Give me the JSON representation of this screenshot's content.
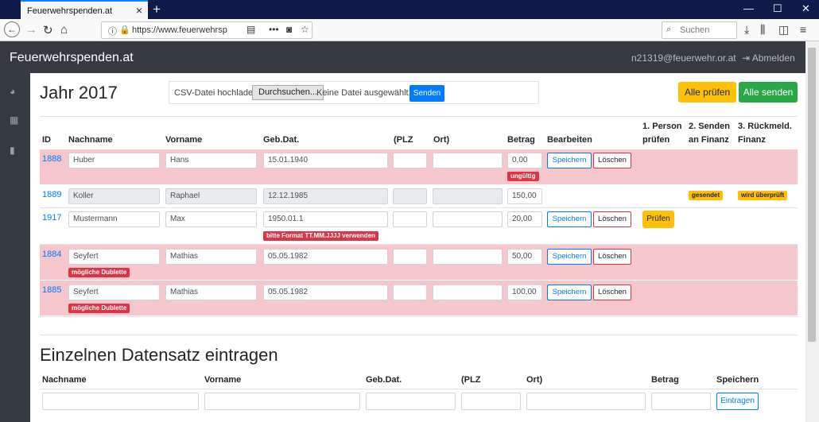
{
  "browser": {
    "tab_title": "Feuerwehrspenden.at",
    "url": "https://www.feuerwehrspenden",
    "search_placeholder": "Suchen"
  },
  "app": {
    "brand": "Feuerwehrspenden.at",
    "user_email": "n21319@feuerwehr.or.at",
    "logout": "Abmelden"
  },
  "page": {
    "year_title": "Jahr 2017",
    "csv_label": "CSV-Datei hochladen:",
    "browse_label": "Durchsuchen...",
    "no_file": "Keine Datei ausgewählt.",
    "send_label": "Senden",
    "check_all": "Alle prüfen",
    "send_all": "Alle senden"
  },
  "table": {
    "headers": {
      "id": "ID",
      "lastname": "Nachname",
      "firstname": "Vorname",
      "dob": "Geb.Dat.",
      "plz": "(PLZ",
      "ort": "Ort)",
      "amount": "Betrag",
      "edit": "Bearbeiten",
      "c1a": "1. Person",
      "c1b": "prüfen",
      "c2a": "2. Senden",
      "c2b": "an Finanz",
      "c3a": "3. Rückmeld.",
      "c3b": "Finanz"
    },
    "save_label": "Speichern",
    "delete_label": "Löschen",
    "check_label": "Prüfen",
    "rows": [
      {
        "id": "1888",
        "lastname": "Huber",
        "firstname": "Hans",
        "dob": "15.01.1940",
        "plz": "",
        "ort": "",
        "amount": "0,00",
        "amount_badge": "ungültig"
      },
      {
        "id": "1889",
        "lastname": "Koller",
        "firstname": "Raphael",
        "dob": "12.12.1985",
        "plz": "",
        "ort": "",
        "amount": "150,00",
        "status_sent": "gesendet",
        "status_feedback": "wird überprüft"
      },
      {
        "id": "1917",
        "lastname": "Mustermann",
        "firstname": "Max",
        "dob": "1950.01.1",
        "plz": "",
        "ort": "",
        "amount": "20,00",
        "dob_badge": "bitte Format TT.MM.JJJJ verwenden"
      },
      {
        "id": "1884",
        "lastname": "Seyfert",
        "firstname": "Mathias",
        "dob": "05.05.1982",
        "plz": "",
        "ort": "",
        "amount": "50,00",
        "name_badge": "mögliche Dublette"
      },
      {
        "id": "1885",
        "lastname": "Seyfert",
        "firstname": "Mathias",
        "dob": "05.05.1982",
        "plz": "",
        "ort": "",
        "amount": "100,00",
        "name_badge": "mögliche Dublette"
      }
    ]
  },
  "single": {
    "title": "Einzelnen Datensatz eintragen",
    "h_lastname": "Nachname",
    "h_firstname": "Vorname",
    "h_dob": "Geb.Dat.",
    "h_plz": "(PLZ",
    "h_ort": "Ort)",
    "h_amount": "Betrag",
    "h_save": "Speichern",
    "submit": "Eintragen"
  },
  "colors": {
    "nav_bg": "#343a40",
    "danger_row": "#f5c6cb",
    "primary": "#007bff",
    "warning": "#ffc107",
    "success": "#28a745"
  }
}
